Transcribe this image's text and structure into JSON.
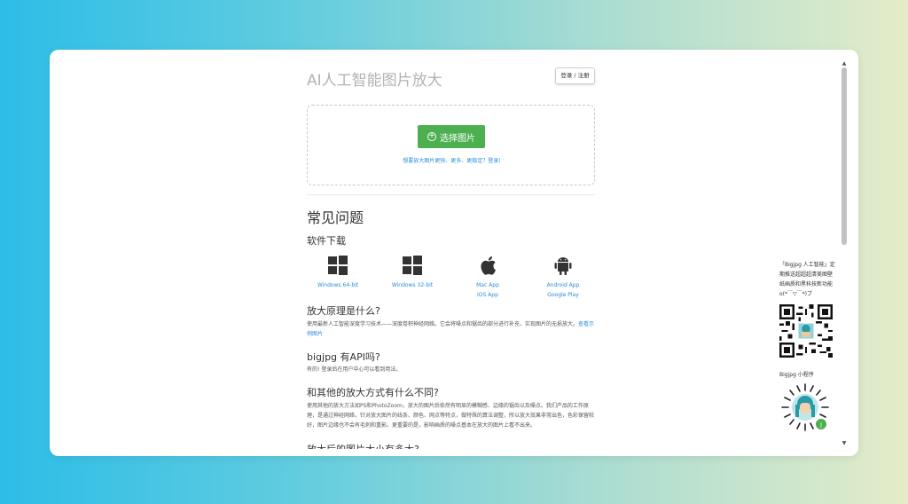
{
  "header": {
    "title": "AI人工智能图片放大",
    "login_label": "登录 / 注册"
  },
  "upload": {
    "button_label": "选择图片",
    "hint": "想要放大图片更快、更多、更稳定？登录!"
  },
  "faq": {
    "title": "常见问题",
    "downloads": {
      "title": "软件下载",
      "items": [
        {
          "icon": "windows-icon",
          "links": [
            "Windows 64-bit"
          ]
        },
        {
          "icon": "windows-icon",
          "links": [
            "Windows 32-bit"
          ]
        },
        {
          "icon": "apple-icon",
          "links": [
            "Mac App",
            "iOS App"
          ]
        },
        {
          "icon": "android-icon",
          "links": [
            "Android App",
            "Google Play"
          ]
        }
      ]
    },
    "principle": {
      "title": "放大原理是什么?",
      "text": "使用最新人工智能深度学习技术——深度卷积神经网络。它会将噪点和锯齿的部分进行补充，实现图片的无损放大。",
      "link": "查看示例图片"
    },
    "api": {
      "title": "bigjpg 有API吗?",
      "text": "有的! 登录后在用户中心可以看到用法。"
    },
    "compare": {
      "title": "和其他的放大方式有什么不同?",
      "text": "使用其他的放大方法如PS和PhotoZoom，放大的图片后依然有明显的模糊感、边缘的锯齿以及噪点。我们产品的工作原理，是通过神经网络，针对放大图片的线条、颜色、网点等特点，做特殊的算法调整，所以放大效果非常出色，色彩保留较好，图片边缘也不会有毛刺和重影。更重要的是，影响画质的噪点基本在放大的图片上看不出来。"
    },
    "cut_heading": "放大后的图片大小有多大?"
  },
  "sidebar": {
    "text": "「Bigjpg 人工智能」定期推送超超超清美图壁纸画质和黑科技新功能 o(*￣▽￣*)ブ",
    "mini_label": "Bigjpg 小程序"
  },
  "colors": {
    "accent": "#4caf50",
    "link": "#2a8ce0"
  }
}
